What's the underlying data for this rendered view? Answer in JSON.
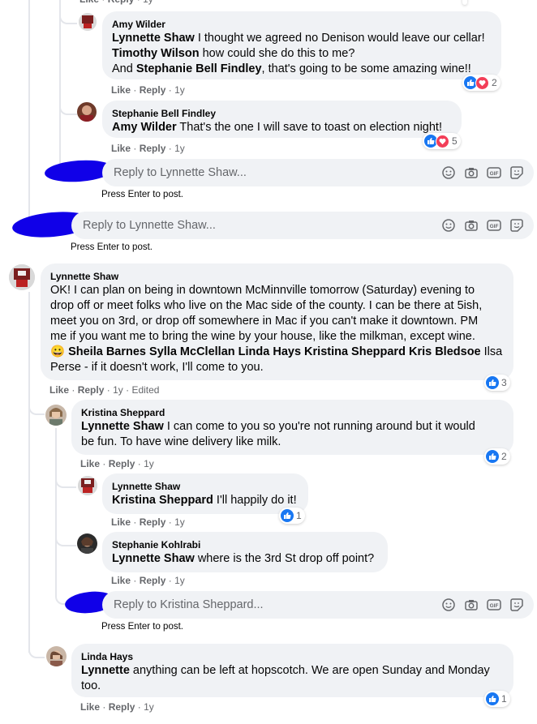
{
  "labels": {
    "like": "Like",
    "reply": "Reply",
    "dot": "·",
    "age": "1y",
    "edited": "Edited",
    "press_enter": "Press Enter to post."
  },
  "top_stub": {
    "text": "Like · Reply · 1y"
  },
  "comments": [
    {
      "id": "amy",
      "author": "Amy Wilder",
      "lines": [
        [
          {
            "m": "Lynnette Shaw"
          },
          {
            "t": " I thought we agreed no Denison would leave our cellar!"
          }
        ],
        [
          {
            "m": "Timothy Wilson"
          },
          {
            "t": " how could she do this to me?"
          }
        ],
        [
          {
            "t": "And "
          },
          {
            "m": "Stephanie Bell Findley"
          },
          {
            "t": ", that's going to be some amazing wine!!"
          }
        ]
      ],
      "reaction_count": "2"
    },
    {
      "id": "stephanie-bf",
      "author": "Stephanie Bell Findley",
      "lines": [
        [
          {
            "m": "Amy Wilder"
          },
          {
            "t": " That's the one I will save to toast on election night!"
          }
        ]
      ],
      "reaction_count": "5"
    },
    {
      "id": "lynnette-main",
      "author": "Lynnette Shaw",
      "lines": [
        [
          {
            "t": "OK! I can plan on being in downtown McMinnville tomorrow (Saturday) evening to"
          }
        ],
        [
          {
            "t": "drop off or meet folks who live on the Mac side of the county. I can be there at 5ish,"
          }
        ],
        [
          {
            "t": "meet you on 3rd, or drop off somewhere in Mac if you can't make it downtown. PM"
          }
        ],
        [
          {
            "t": "me if you want me to bring the wine by your house, like the milkman, except wine."
          }
        ],
        [
          {
            "e": "😀"
          },
          {
            "t": " "
          },
          {
            "m": "Sheila Barnes"
          },
          {
            "t": " "
          },
          {
            "m": "Sylla McClellan"
          },
          {
            "t": " "
          },
          {
            "m": "Linda Hays"
          },
          {
            "t": " "
          },
          {
            "m": "Kristina Sheppard"
          },
          {
            "t": " "
          },
          {
            "m": "Kris Bledsoe"
          },
          {
            "t": " Ilsa"
          }
        ],
        [
          {
            "t": "Perse - if it doesn't work, I'll come to you."
          }
        ]
      ],
      "reaction_count": "3"
    },
    {
      "id": "kristina",
      "author": "Kristina Sheppard",
      "lines": [
        [
          {
            "m": "Lynnette Shaw"
          },
          {
            "t": " I can come to you so you're not running around but it would"
          }
        ],
        [
          {
            "t": "be fun. To have wine delivery like milk."
          }
        ]
      ],
      "reaction_count": "2"
    },
    {
      "id": "lynnette-reply",
      "author": "Lynnette Shaw",
      "lines": [
        [
          {
            "m": "Kristina Sheppard"
          },
          {
            "t": " I'll happily do it!"
          }
        ]
      ],
      "reaction_count": "1"
    },
    {
      "id": "stephanie-k",
      "author": "Stephanie Kohlrabi",
      "lines": [
        [
          {
            "m": "Lynnette Shaw"
          },
          {
            "t": " where is the 3rd St drop off point?"
          }
        ]
      ],
      "reaction_count": ""
    },
    {
      "id": "linda",
      "author": "Linda Hays",
      "lines": [
        [
          {
            "m": "Lynnette"
          },
          {
            "t": " anything can be left at hopscotch. We are open Sunday and Monday"
          }
        ],
        [
          {
            "t": "too."
          }
        ]
      ],
      "reaction_count": "1"
    }
  ],
  "inputs": [
    {
      "id": "reply-lynnette-1",
      "placeholder": "Reply to Lynnette Shaw..."
    },
    {
      "id": "reply-lynnette-2",
      "placeholder": "Reply to Lynnette Shaw..."
    },
    {
      "id": "reply-kristina",
      "placeholder": "Reply to Kristina Sheppard..."
    }
  ],
  "icons": [
    "smiley-icon",
    "camera-icon",
    "gif-icon",
    "sticker-icon",
    "like-reaction-icon",
    "love-reaction-icon"
  ],
  "colors": {
    "bubble": "#f0f2f5",
    "meta": "#65676b",
    "like_blue": "#1877f2",
    "love_red": "#f33e58",
    "redaction": "#1000e8"
  }
}
